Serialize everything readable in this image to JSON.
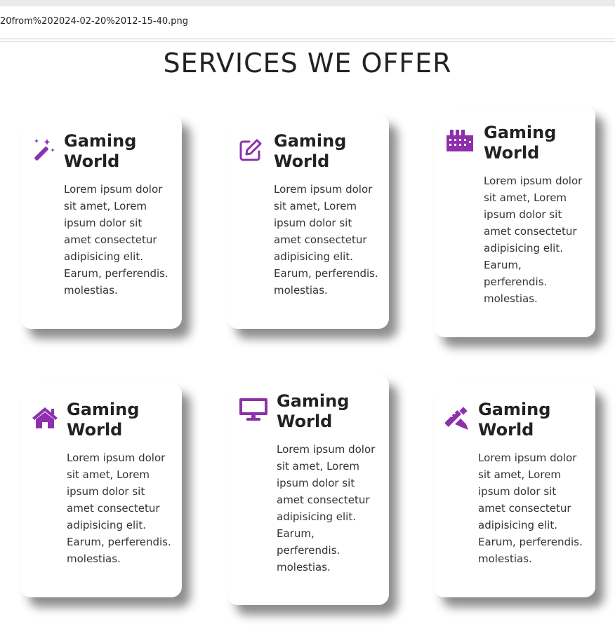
{
  "browser": {
    "url_text": "20from%202024-02-20%2012-15-40.png"
  },
  "page": {
    "title": "SERVICES WE OFFER"
  },
  "theme": {
    "accent": "#8e2fad",
    "text": "#222222"
  },
  "cards": [
    {
      "icon": "magic-wand-icon",
      "title_line1": "Gaming",
      "title_line2": "World",
      "desc_lines": [
        "Lorem ipsum dolor",
        "sit amet, Lorem",
        "ipsum dolor sit",
        "amet consectetur",
        "adipisicing elit.",
        "Earum, perferendis.",
        "molestias."
      ]
    },
    {
      "icon": "edit-icon",
      "title_line1": "Gaming",
      "title_line2": "World",
      "desc_lines": [
        "Lorem ipsum dolor",
        "sit amet, Lorem",
        "ipsum dolor sit",
        "amet consectetur",
        "adipisicing elit.",
        "Earum, perferendis.",
        "molestias."
      ]
    },
    {
      "icon": "city-icon",
      "title_line1": "Gaming",
      "title_line2": "World",
      "desc_lines": [
        "Lorem ipsum dolor",
        "sit amet, Lorem",
        "ipsum dolor sit",
        "amet consectetur",
        "adipisicing elit.",
        "Earum,",
        "perferendis.",
        "molestias."
      ]
    },
    {
      "icon": "home-icon",
      "title_line1": "Gaming",
      "title_line2": "World",
      "desc_lines": [
        "Lorem ipsum dolor",
        "sit amet, Lorem",
        "ipsum dolor sit",
        "amet consectetur",
        "adipisicing elit.",
        "Earum, perferendis.",
        "molestias."
      ]
    },
    {
      "icon": "monitor-icon",
      "title_line1": "Gaming",
      "title_line2": "World",
      "desc_lines": [
        "Lorem ipsum dolor",
        "sit amet, Lorem",
        "ipsum dolor sit",
        "amet consectetur",
        "adipisicing elit.",
        "Earum,",
        "perferendis.",
        "molestias."
      ]
    },
    {
      "icon": "design-tools-icon",
      "title_line1": "Gaming",
      "title_line2": "World",
      "desc_lines": [
        "Lorem ipsum dolor",
        "sit amet, Lorem",
        "ipsum dolor sit",
        "amet consectetur",
        "adipisicing elit.",
        "Earum, perferendis.",
        "molestias."
      ]
    }
  ]
}
